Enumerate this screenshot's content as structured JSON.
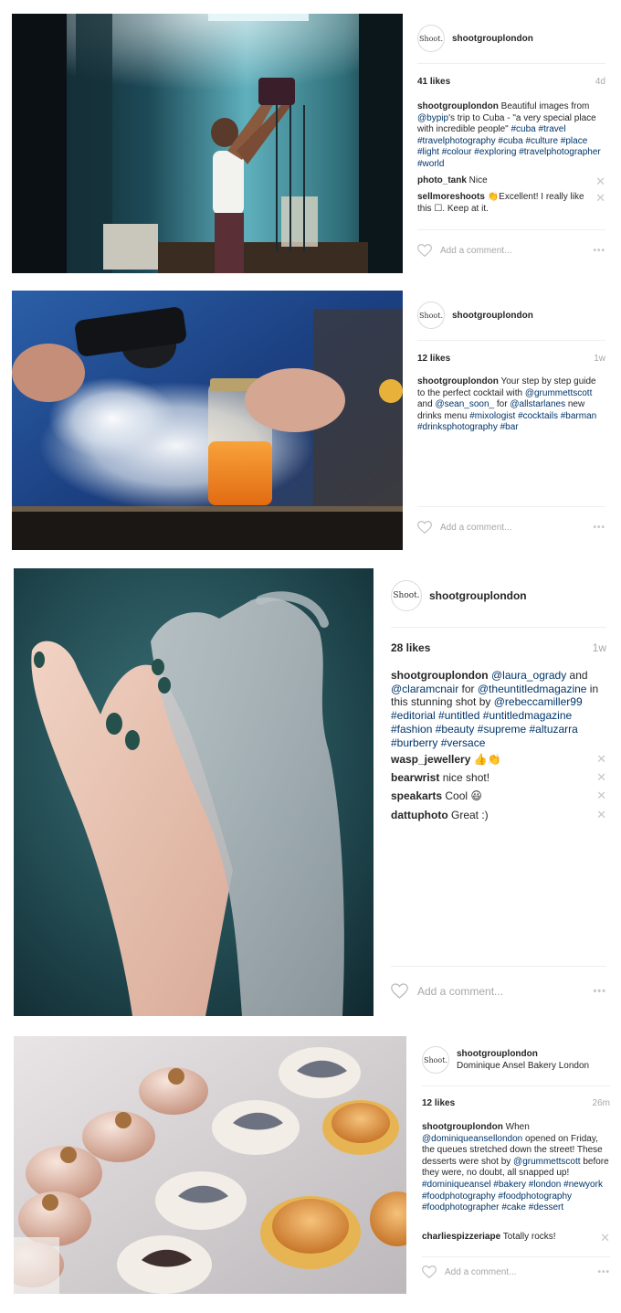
{
  "posts": [
    {
      "username": "shootgrouplondon",
      "avatar_text": "Shoot.",
      "likes": "41 likes",
      "age": "4d",
      "caption_user": "shootgrouplondon",
      "caption_parts": [
        {
          "t": " Beautiful images from "
        },
        {
          "t": "@bypip",
          "tag": true
        },
        {
          "t": "'s trip to Cuba - \"a very special place with incredible people\" "
        },
        {
          "t": "#cuba",
          "tag": true
        },
        {
          "t": " "
        },
        {
          "t": "#travel",
          "tag": true
        },
        {
          "t": " "
        },
        {
          "t": "#travelphotography",
          "tag": true
        },
        {
          "t": " "
        },
        {
          "t": "#cuba",
          "tag": true
        },
        {
          "t": " "
        },
        {
          "t": "#culture",
          "tag": true
        },
        {
          "t": " "
        },
        {
          "t": "#place",
          "tag": true
        },
        {
          "t": " "
        },
        {
          "t": "#light",
          "tag": true
        },
        {
          "t": " "
        },
        {
          "t": "#colour",
          "tag": true
        },
        {
          "t": " "
        },
        {
          "t": "#exploring",
          "tag": true
        },
        {
          "t": " "
        },
        {
          "t": "#travelphotographer",
          "tag": true
        },
        {
          "t": " "
        },
        {
          "t": "#world",
          "tag": true
        }
      ],
      "comments": [
        {
          "user": "photo_tank",
          "text": " Nice"
        },
        {
          "user": "sellmoreshoots",
          "text": " 👏Excellent! I really like this ☐. Keep at it."
        }
      ],
      "add_comment_placeholder": "Add a comment...",
      "more_label": "•••"
    },
    {
      "username": "shootgrouplondon",
      "avatar_text": "Shoot.",
      "likes": "12 likes",
      "age": "1w",
      "caption_user": "shootgrouplondon",
      "caption_parts": [
        {
          "t": " Your step by step guide to the perfect cocktail with "
        },
        {
          "t": "@grummettscott",
          "tag": true
        },
        {
          "t": " and "
        },
        {
          "t": "@sean_soon_",
          "tag": true
        },
        {
          "t": " for "
        },
        {
          "t": "@allstarlanes",
          "tag": true
        },
        {
          "t": " new drinks menu "
        },
        {
          "t": "#mixologist",
          "tag": true
        },
        {
          "t": " "
        },
        {
          "t": "#cocktails",
          "tag": true
        },
        {
          "t": " "
        },
        {
          "t": "#barman",
          "tag": true
        },
        {
          "t": " "
        },
        {
          "t": "#drinksphotography",
          "tag": true
        },
        {
          "t": " "
        },
        {
          "t": "#bar",
          "tag": true
        }
      ],
      "comments": [],
      "add_comment_placeholder": "Add a comment...",
      "more_label": "•••"
    },
    {
      "username": "shootgrouplondon",
      "avatar_text": "Shoot.",
      "likes": "28 likes",
      "age": "1w",
      "caption_user": "shootgrouplondon",
      "caption_parts": [
        {
          "t": " "
        },
        {
          "t": "@laura_ogrady",
          "tag": true
        },
        {
          "t": " and "
        },
        {
          "t": "@claramcnair",
          "tag": true
        },
        {
          "t": " for "
        },
        {
          "t": "@theuntitledmagazine",
          "tag": true
        },
        {
          "t": " in this stunning shot by "
        },
        {
          "t": "@rebeccamiller99",
          "tag": true
        },
        {
          "t": " "
        },
        {
          "t": "#editorial",
          "tag": true
        },
        {
          "t": " "
        },
        {
          "t": "#untitled",
          "tag": true
        },
        {
          "t": " "
        },
        {
          "t": "#untitledmagazine",
          "tag": true
        },
        {
          "t": " "
        },
        {
          "t": "#fashion",
          "tag": true
        },
        {
          "t": " "
        },
        {
          "t": "#beauty",
          "tag": true
        },
        {
          "t": " "
        },
        {
          "t": "#supreme",
          "tag": true
        },
        {
          "t": " "
        },
        {
          "t": "#altuzarra",
          "tag": true
        },
        {
          "t": " "
        },
        {
          "t": "#burberry",
          "tag": true
        },
        {
          "t": " "
        },
        {
          "t": "#versace",
          "tag": true
        }
      ],
      "comments": [
        {
          "user": "wasp_jewellery",
          "text": " 👍👏"
        },
        {
          "user": "bearwrist",
          "text": " nice shot!"
        },
        {
          "user": "speakarts",
          "text": " Cool 😃"
        },
        {
          "user": "dattuphoto",
          "text": " Great :)"
        }
      ],
      "add_comment_placeholder": "Add a comment...",
      "more_label": "•••"
    },
    {
      "username": "shootgrouplondon",
      "location": "Dominique Ansel Bakery London",
      "avatar_text": "Shoot.",
      "likes": "12 likes",
      "age": "26m",
      "caption_user": "shootgrouplondon",
      "caption_parts": [
        {
          "t": " When "
        },
        {
          "t": "@dominiqueansellondon",
          "tag": true
        },
        {
          "t": " opened on Friday, the queues stretched down the street! These desserts were shot by "
        },
        {
          "t": "@grummettscott",
          "tag": true
        },
        {
          "t": " before they were, no doubt, all snapped up! "
        },
        {
          "t": "#dominiqueansel",
          "tag": true
        },
        {
          "t": " "
        },
        {
          "t": "#bakery",
          "tag": true
        },
        {
          "t": " "
        },
        {
          "t": "#london",
          "tag": true
        },
        {
          "t": " "
        },
        {
          "t": "#newyork",
          "tag": true
        },
        {
          "t": " "
        },
        {
          "t": "#foodphotography",
          "tag": true
        },
        {
          "t": " "
        },
        {
          "t": "#foodphotography",
          "tag": true
        },
        {
          "t": " "
        },
        {
          "t": "#foodphotographer",
          "tag": true
        },
        {
          "t": " "
        },
        {
          "t": "#cake",
          "tag": true
        },
        {
          "t": " "
        },
        {
          "t": "#dessert",
          "tag": true
        }
      ],
      "comments": [
        {
          "user": "charliespizzeriape",
          "text": " Totally rocks!"
        }
      ],
      "add_comment_placeholder": "Add a comment...",
      "more_label": "•••"
    }
  ],
  "close_glyph": "✕"
}
